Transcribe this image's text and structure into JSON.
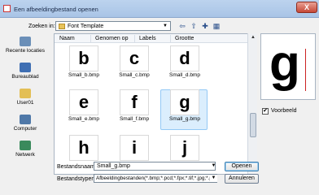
{
  "window": {
    "title": "Een afbeeldingbestand openen",
    "close_label": "X"
  },
  "lookin": {
    "label": "Zoeken in:",
    "value": "Font Template"
  },
  "toolbar": {
    "back_icon": "back-arrow-icon",
    "up_icon": "up-folder-icon",
    "new_icon": "new-folder-icon",
    "views_icon": "views-menu-icon"
  },
  "places": [
    {
      "label": "Recente locaties",
      "icon": "recent-places-icon",
      "color": "#6b8fb8"
    },
    {
      "label": "Bureaublad",
      "icon": "desktop-icon",
      "color": "#3f6fb3"
    },
    {
      "label": "User01",
      "icon": "user-folder-icon",
      "color": "#e3bf55"
    },
    {
      "label": "Computer",
      "icon": "computer-icon",
      "color": "#4f78a8"
    },
    {
      "label": "Netwerk",
      "icon": "network-icon",
      "color": "#3a8a5c"
    }
  ],
  "columns": [
    "Naam",
    "Genomen op",
    "Labels",
    "Grootte"
  ],
  "more_columns": "»",
  "files": [
    {
      "letter": "b",
      "name": "Small_b.bmp"
    },
    {
      "letter": "c",
      "name": "Small_c.bmp"
    },
    {
      "letter": "d",
      "name": "Small_d.bmp"
    },
    {
      "letter": "e",
      "name": "Small_e.bmp"
    },
    {
      "letter": "f",
      "name": "Small_f.bmp"
    },
    {
      "letter": "g",
      "name": "Small_g.bmp"
    },
    {
      "letter": "h",
      "name": ""
    },
    {
      "letter": "i",
      "name": ""
    },
    {
      "letter": "j",
      "name": ""
    }
  ],
  "selected_index": 5,
  "preview": {
    "letter": "g",
    "checkbox_label": "Voorbeeld",
    "checked": true
  },
  "filename": {
    "label": "Bestandsnaam:",
    "value": "Small_g.bmp"
  },
  "filetype": {
    "label": "Bestandstypen:",
    "value": "Afbeeldingbestanden(*.bmp;*.pcd;*.fpx;*.tif;*.jpg;*.pcx"
  },
  "buttons": {
    "open": "Openen",
    "cancel": "Annuleren"
  }
}
